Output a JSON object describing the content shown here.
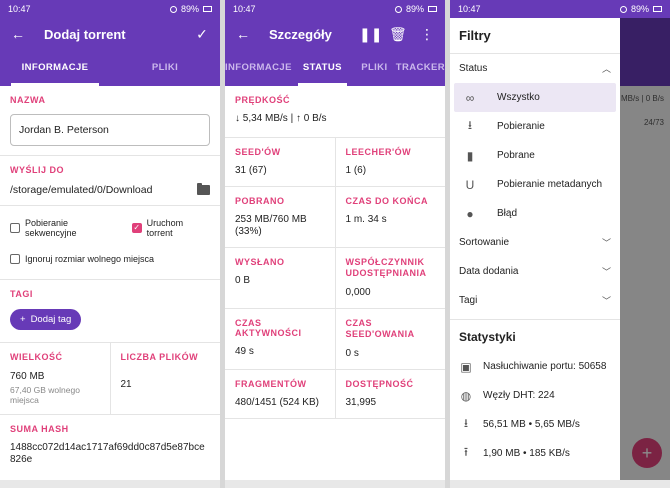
{
  "status_bar": {
    "time": "10:47",
    "net": "VoLTE",
    "battery": "89%"
  },
  "panel1": {
    "title": "Dodaj torrent",
    "tabs": [
      "INFORMACJE",
      "PLIKI"
    ],
    "name_label": "NAZWA",
    "name_value": "Jordan B. Peterson",
    "send_label": "WYŚLIJ DO",
    "send_path": "/storage/emulated/0/Download",
    "checks": [
      {
        "label": "Pobieranie sekwencyjne",
        "checked": false
      },
      {
        "label": "Uruchom torrent",
        "checked": true
      },
      {
        "label": "Ignoruj rozmiar wolnego miejsca",
        "checked": false
      }
    ],
    "tags_label": "TAGI",
    "add_tag": "Dodaj tag",
    "size_label": "WIELKOŚĆ",
    "size_value": "760 MB",
    "free_space": "67,40 GB wolnego miejsca",
    "files_label": "LICZBA PLIKÓW",
    "files_value": "21",
    "hash_label": "SUMA HASH",
    "hash_value": "1488cc072d14ac1717af69dd0c87d5e87bce826e"
  },
  "panel2": {
    "title": "Szczegóły",
    "tabs": [
      "INFORMACJE",
      "STATUS",
      "PLIKI",
      "TRACKER"
    ],
    "speed_label": "PRĘDKOŚĆ",
    "speed_value": "↓ 5,34 MB/s | ↑ 0 B/s",
    "seeds_label": "SEED'ÓW",
    "seeds_value": "31 (67)",
    "leechers_label": "LEECHER'ÓW",
    "leechers_value": "1 (6)",
    "downloaded_label": "POBRANO",
    "downloaded_value": "253 MB/760 MB (33%)",
    "eta_label": "CZAS DO KOŃCA",
    "eta_value": "1 m. 34 s",
    "uploaded_label": "WYSŁANO",
    "uploaded_value": "0 B",
    "ratio_label": "WSPÓŁCZYNNIK UDOSTĘPNIANIA",
    "ratio_value": "0,000",
    "active_label": "CZAS AKTYWNOŚCI",
    "active_value": "49 s",
    "seeding_label": "CZAS SEED'OWANIA",
    "seeding_value": "0 s",
    "pieces_label": "FRAGMENTÓW",
    "pieces_value": "480/1451 (524 KB)",
    "avail_label": "DOSTĘPNOŚĆ",
    "avail_value": "31,995"
  },
  "panel3": {
    "drawer_title": "Filtry",
    "status_header": "Status",
    "filters": [
      {
        "label": "Wszystko",
        "icon": "infinity-icon",
        "active": true
      },
      {
        "label": "Pobieranie",
        "icon": "download-icon",
        "active": false
      },
      {
        "label": "Pobrane",
        "icon": "file-icon",
        "active": false
      },
      {
        "label": "Pobieranie metadanych",
        "icon": "magnet-icon",
        "active": false
      },
      {
        "label": "Błąd",
        "icon": "error-icon",
        "active": false
      }
    ],
    "sorting_header": "Sortowanie",
    "date_header": "Data dodania",
    "tags_header": "Tagi",
    "stats_title": "Statystyki",
    "stats": [
      {
        "label": "Nasłuchiwanie portu: 50658",
        "icon": "port-icon"
      },
      {
        "label": "Węzły DHT: 224",
        "icon": "globe-icon"
      },
      {
        "label": "56,51 MB • 5,65 MB/s",
        "icon": "download-icon"
      },
      {
        "label": "1,90 MB • 185 KB/s",
        "icon": "upload-icon"
      }
    ],
    "bg_text_1": "MB/s | 0 B/s",
    "bg_text_2": "24/73"
  }
}
